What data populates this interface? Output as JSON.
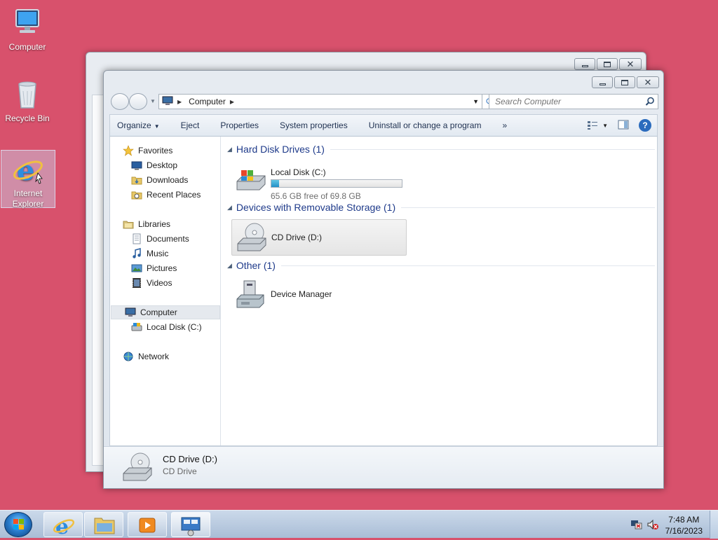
{
  "desktop": {
    "icons": [
      {
        "label": "Computer",
        "icon": "computer-icon"
      },
      {
        "label": "Recycle Bin",
        "icon": "recycle-bin-icon"
      },
      {
        "label": "Internet Explorer",
        "icon": "internet-explorer-icon",
        "selected": true
      }
    ],
    "background_color": "#d8516c"
  },
  "window": {
    "address": {
      "path": "Computer",
      "icon": "computer-icon"
    },
    "search": {
      "placeholder": "Search Computer"
    },
    "toolbar": {
      "organize": "Organize",
      "eject": "Eject",
      "properties": "Properties",
      "system_properties": "System properties",
      "uninstall": "Uninstall or change a program",
      "more": "»"
    },
    "nav": {
      "favorites": "Favorites",
      "desktop": "Desktop",
      "downloads": "Downloads",
      "recent_places": "Recent Places",
      "libraries": "Libraries",
      "documents": "Documents",
      "music": "Music",
      "pictures": "Pictures",
      "videos": "Videos",
      "computer": "Computer",
      "local_disk": "Local Disk (C:)",
      "network": "Network"
    },
    "groups": {
      "hdd": {
        "title": "Hard Disk Drives (1)"
      },
      "removable": {
        "title": "Devices with Removable Storage (1)"
      },
      "other": {
        "title": "Other (1)"
      }
    },
    "items": {
      "local_disk": {
        "name": "Local Disk (C:)",
        "free_text": "65.6 GB free of 69.8 GB",
        "used_fraction": 0.06
      },
      "cd_drive": {
        "name": "CD Drive (D:)"
      },
      "device_manager": {
        "name": "Device Manager"
      }
    },
    "details": {
      "name": "CD Drive (D:)",
      "type": "CD Drive"
    }
  },
  "taskbar": {
    "time": "7:48 AM",
    "date": "7/16/2023",
    "buttons": [
      "start-orb",
      "internet-explorer-icon",
      "windows-explorer-icon",
      "media-player-icon",
      "control-panel-icon"
    ]
  },
  "colors": {
    "accent_title": "#1e3a8a",
    "disk_bar": "#2390c7"
  }
}
